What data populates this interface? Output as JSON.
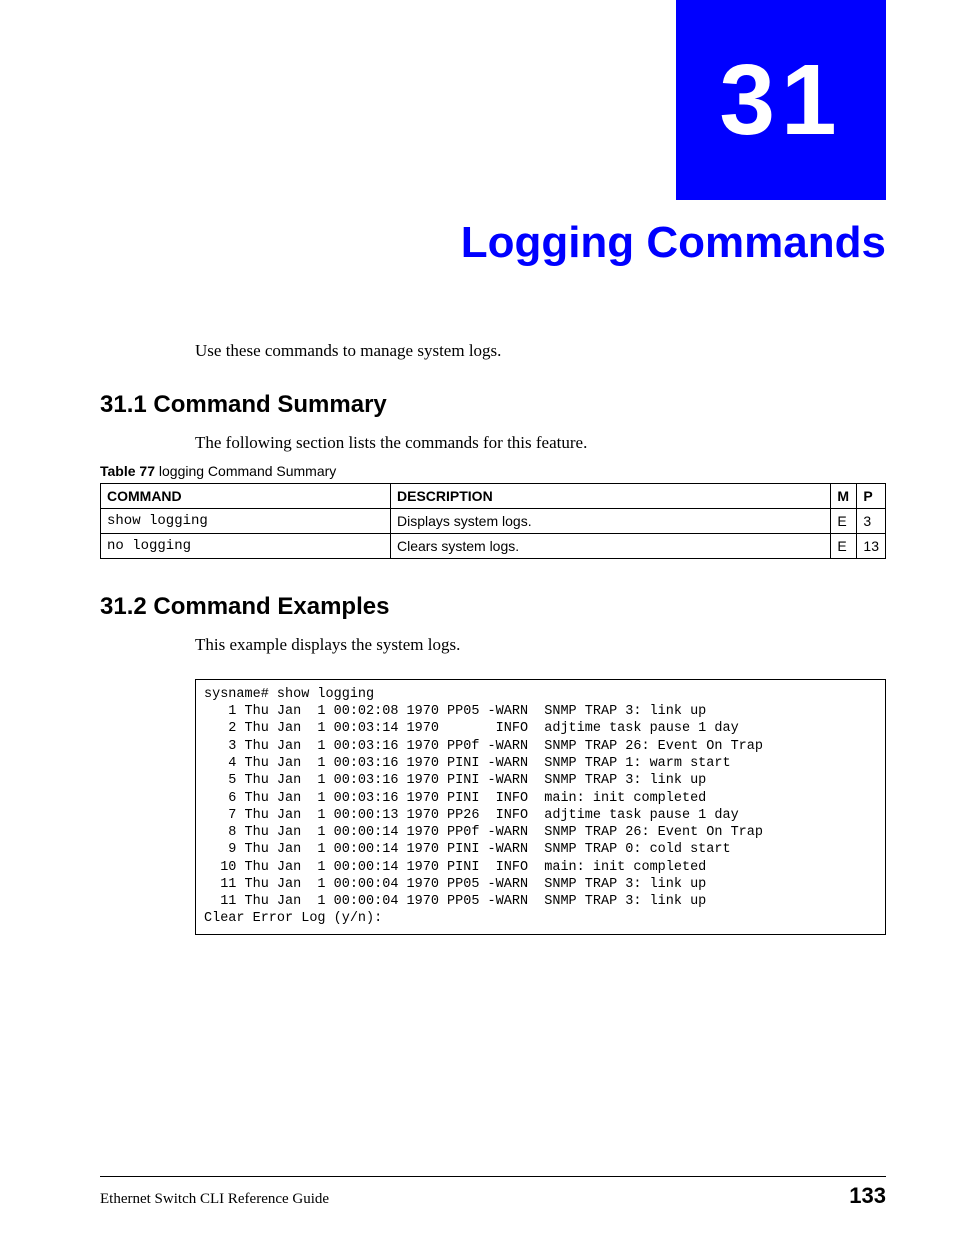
{
  "chapter": {
    "number": "31",
    "title": "Logging Commands",
    "intro": "Use these commands to manage system logs."
  },
  "section1": {
    "heading": "31.1  Command Summary",
    "text": "The following section lists the commands for this feature.",
    "table_caption_bold": "Table 77",
    "table_caption_rest": "   logging Command Summary",
    "headers": {
      "command": "COMMAND",
      "description": "DESCRIPTION",
      "m": "M",
      "p": "P"
    },
    "rows": [
      {
        "command": "show logging",
        "description": "Displays system logs.",
        "m": "E",
        "p": "3"
      },
      {
        "command": "no logging",
        "description": "Clears system logs.",
        "m": "E",
        "p": "13"
      }
    ]
  },
  "section2": {
    "heading": "31.2  Command Examples",
    "text": "This example displays the system logs.",
    "code": "sysname# show logging\n   1 Thu Jan  1 00:02:08 1970 PP05 -WARN  SNMP TRAP 3: link up\n   2 Thu Jan  1 00:03:14 1970       INFO  adjtime task pause 1 day\n   3 Thu Jan  1 00:03:16 1970 PP0f -WARN  SNMP TRAP 26: Event On Trap\n   4 Thu Jan  1 00:03:16 1970 PINI -WARN  SNMP TRAP 1: warm start\n   5 Thu Jan  1 00:03:16 1970 PINI -WARN  SNMP TRAP 3: link up\n   6 Thu Jan  1 00:03:16 1970 PINI  INFO  main: init completed\n   7 Thu Jan  1 00:00:13 1970 PP26  INFO  adjtime task pause 1 day\n   8 Thu Jan  1 00:00:14 1970 PP0f -WARN  SNMP TRAP 26: Event On Trap\n   9 Thu Jan  1 00:00:14 1970 PINI -WARN  SNMP TRAP 0: cold start\n  10 Thu Jan  1 00:00:14 1970 PINI  INFO  main: init completed\n  11 Thu Jan  1 00:00:04 1970 PP05 -WARN  SNMP TRAP 3: link up\n  11 Thu Jan  1 00:00:04 1970 PP05 -WARN  SNMP TRAP 3: link up\nClear Error Log (y/n):"
  },
  "footer": {
    "doc_title": "Ethernet Switch CLI Reference Guide",
    "page": "133"
  }
}
